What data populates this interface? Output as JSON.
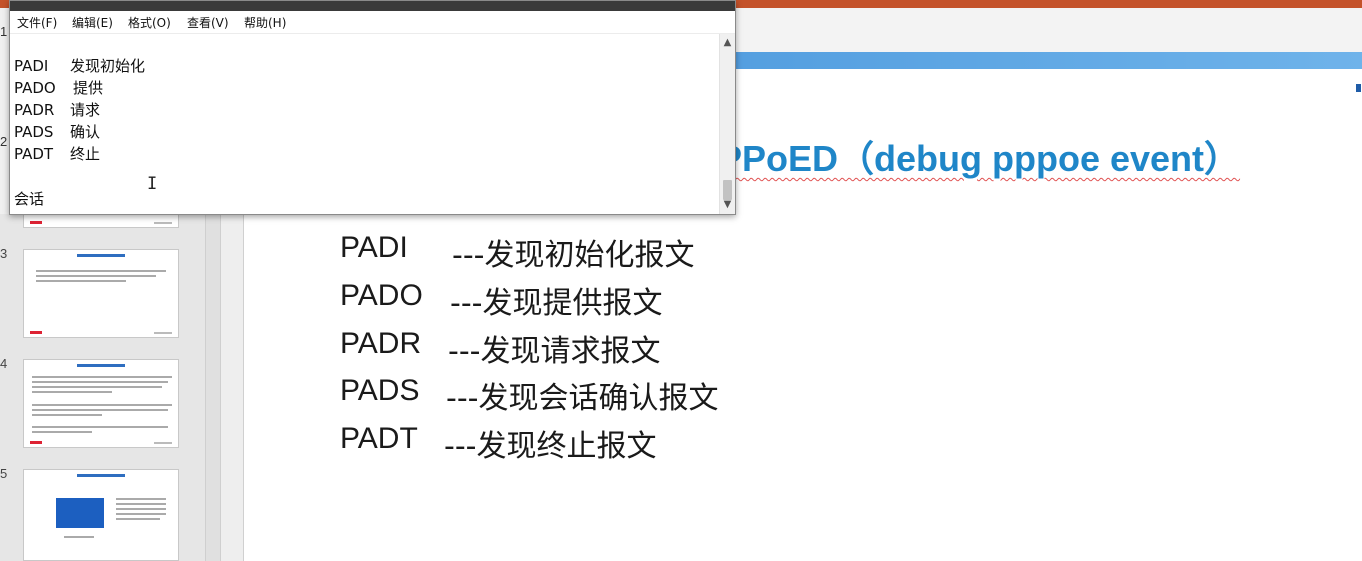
{
  "notepad": {
    "menu": [
      "文件(F)",
      "编辑(E)",
      "格式(O)",
      "查看(V)",
      "帮助(H)"
    ],
    "lines": [
      {
        "code": "PADI",
        "text": "发现初始化"
      },
      {
        "code": "PADO",
        "text": "提供"
      },
      {
        "code": "PADR",
        "text": "请求"
      },
      {
        "code": "PADS",
        "text": "确认"
      },
      {
        "code": "PADT",
        "text": "终止"
      }
    ],
    "extra_line": "会话",
    "scroll_up_icon": "▲",
    "scroll_down_icon": "▼"
  },
  "ppt": {
    "slide_numbers": [
      "1",
      "2",
      "3",
      "4",
      "5"
    ],
    "title": "PPoED（debug pppoe event）",
    "title_visible": "PPoED（debug pppoe event）",
    "rows": [
      {
        "code": "PADI",
        "desc": "---发现初始化报文"
      },
      {
        "code": "PADO",
        "desc": "---发现提供报文"
      },
      {
        "code": "PADR",
        "desc": "---发现请求报文"
      },
      {
        "code": "PADS",
        "desc": "---发现会话确认报文"
      },
      {
        "code": "PADT",
        "desc": "---发现终止报文"
      }
    ],
    "colors": {
      "accent": "#1f86c8",
      "topbar": "#c4522a",
      "band": "#3f8fd8"
    }
  }
}
